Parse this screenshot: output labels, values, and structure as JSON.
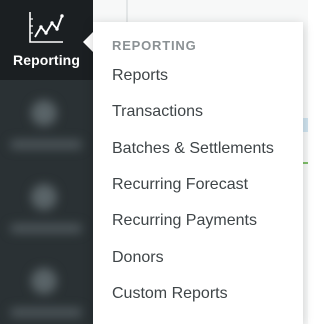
{
  "sidebar": {
    "active_item": {
      "label": "Reporting",
      "icon": "line-chart-icon"
    }
  },
  "menu": {
    "header": "REPORTING",
    "items": [
      {
        "label": "Reports"
      },
      {
        "label": "Transactions"
      },
      {
        "label": "Batches & Settlements"
      },
      {
        "label": "Recurring Forecast"
      },
      {
        "label": "Recurring Payments"
      },
      {
        "label": "Donors"
      },
      {
        "label": "Custom Reports"
      }
    ]
  },
  "colors": {
    "sidebar_bg": "#2a3134",
    "active_bg": "#1b1f22",
    "menu_text": "#3f4548",
    "menu_header": "#8b9194"
  }
}
